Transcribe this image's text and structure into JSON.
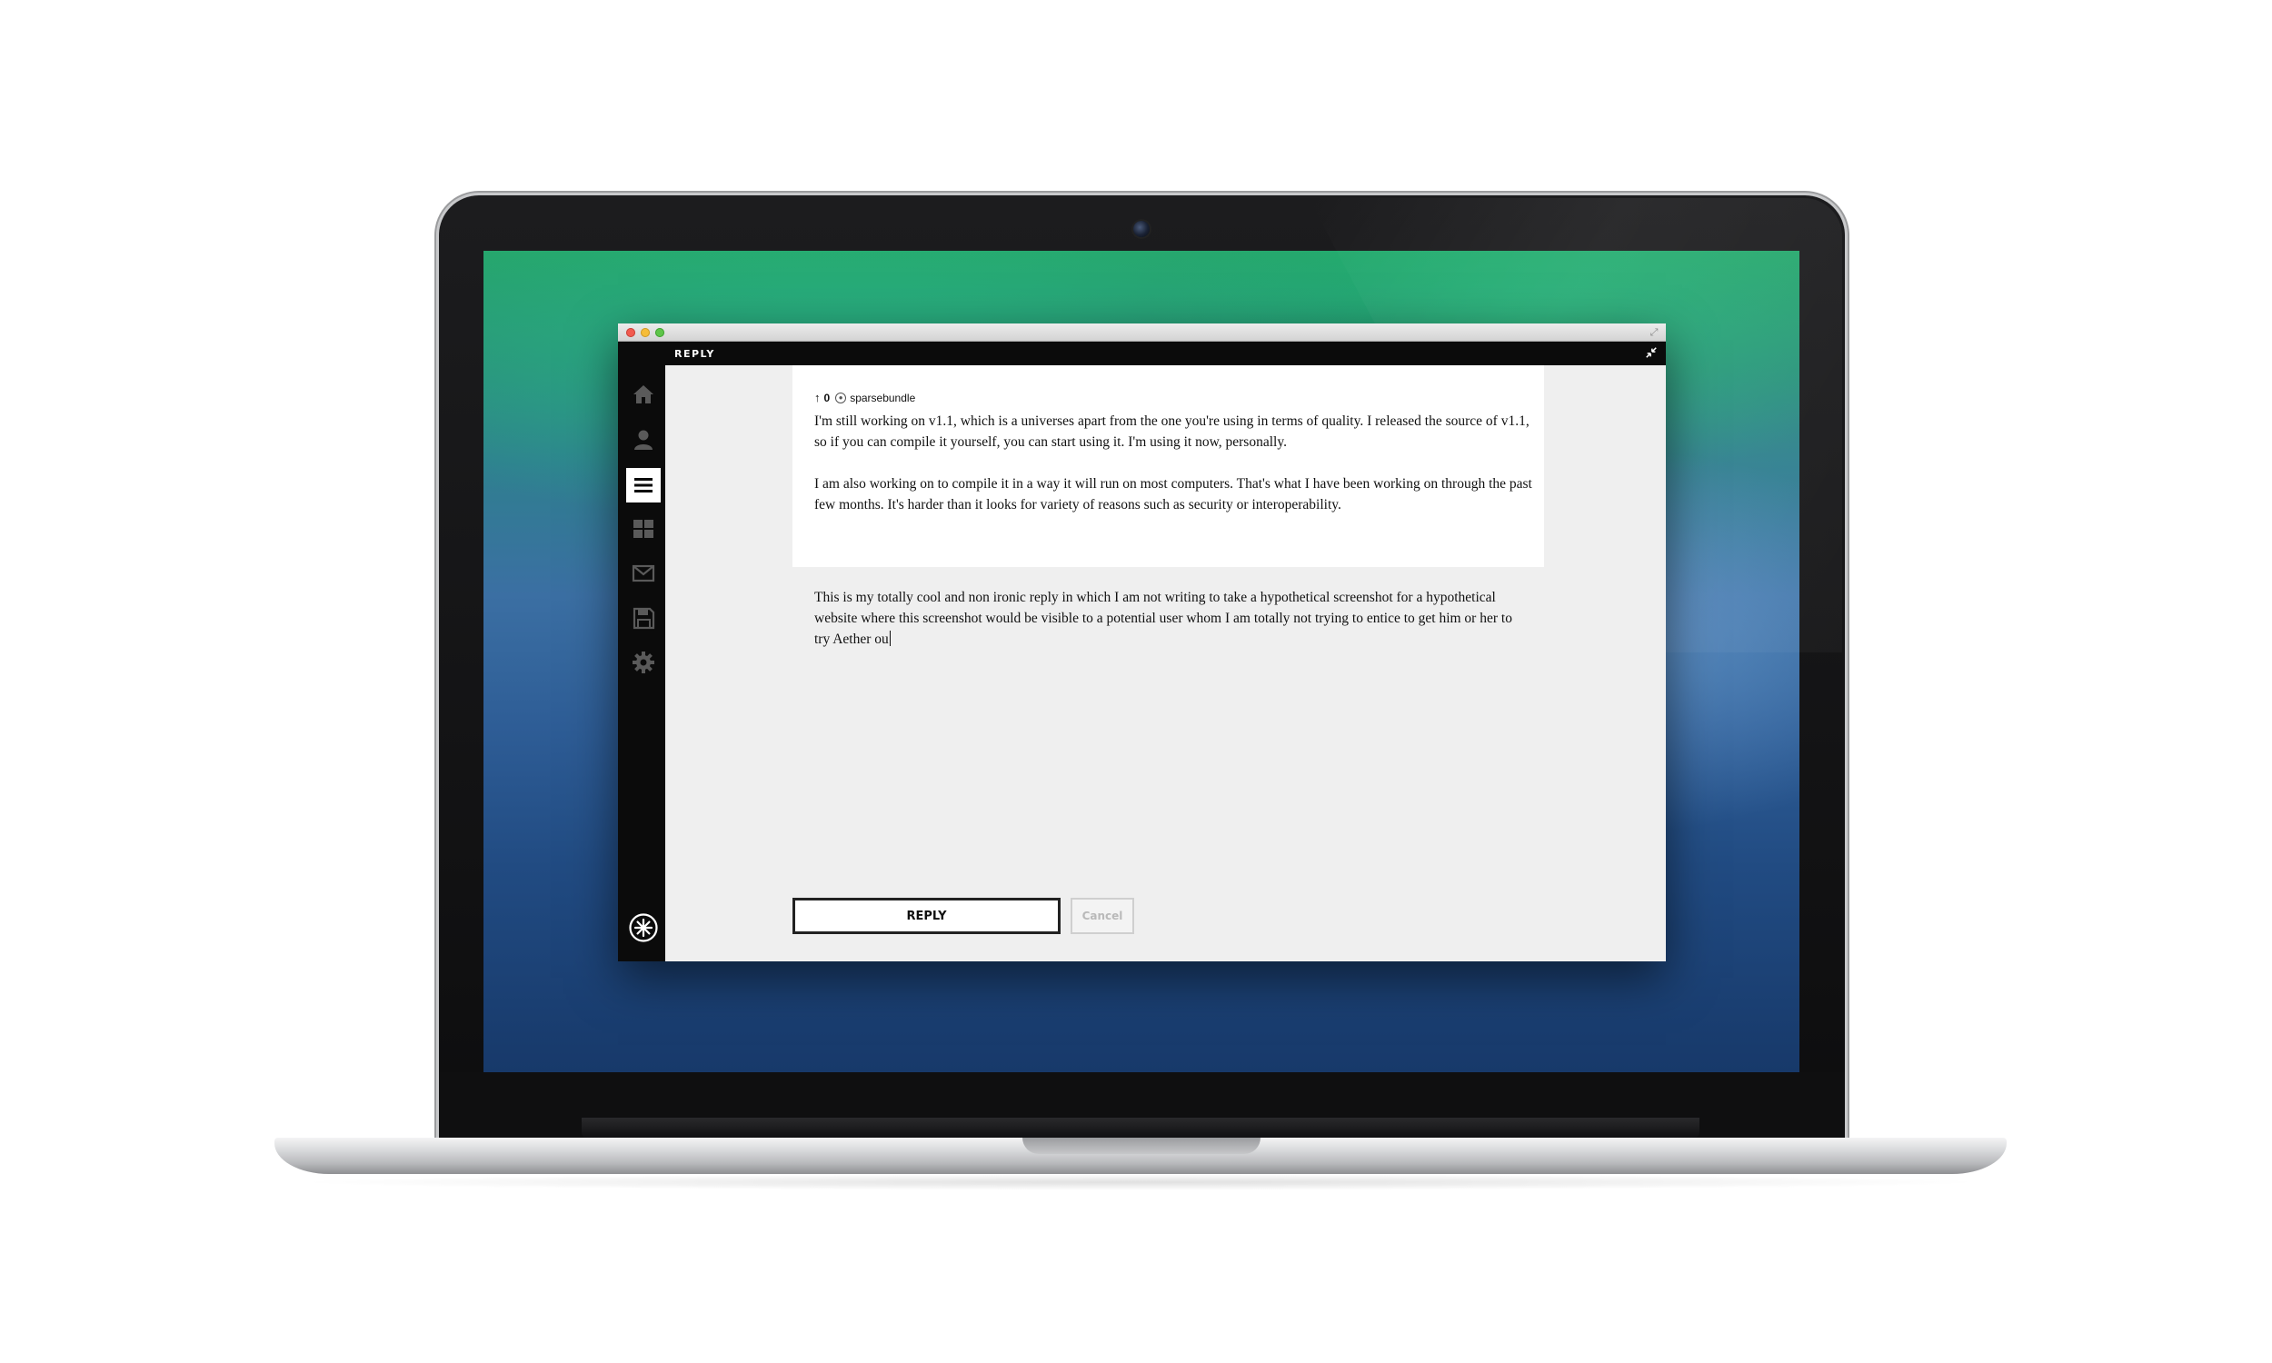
{
  "window": {
    "header_title": "REPLY",
    "icons": [
      "fullscreen-icon",
      "collapse-icon"
    ]
  },
  "sidebar": {
    "items": [
      {
        "name": "home-icon",
        "active": false
      },
      {
        "name": "profile-icon",
        "active": false
      },
      {
        "name": "list-icon",
        "active": true
      },
      {
        "name": "grid-icon",
        "active": false
      },
      {
        "name": "mail-icon",
        "active": false
      },
      {
        "name": "save-icon",
        "active": false
      },
      {
        "name": "gear-icon",
        "active": false
      }
    ],
    "logo": "aether-logo-icon"
  },
  "post": {
    "upvote_icon": "↑",
    "vote_count": "0",
    "username": "sparsebundle",
    "paragraphs": [
      "I'm still working on v1.1, which is a universes apart from the one you're using in terms of quality. I released the source of v1.1, so if you can compile it yourself, you can start using it. I'm using it now, personally.",
      "I am also working on to compile it in a way it will run on most computers. That's what I have been working on through the past few months. It's harder than it looks for variety of reasons such as security or interoperability."
    ]
  },
  "reply": {
    "text": "This is my totally cool and non ironic reply in which I am not writing to take a hypothetical screenshot for a hypothetical website where this screenshot would be visible to a potential user whom I am totally not trying to entice to get him or her to try Aether ou"
  },
  "buttons": {
    "reply_label": "REPLY",
    "cancel_label": "Cancel"
  },
  "colors": {
    "sidebar_bg": "#0b0b0b",
    "content_bg": "#efefef",
    "card_bg": "#ffffff",
    "icon_gray": "#5a5a5a"
  }
}
